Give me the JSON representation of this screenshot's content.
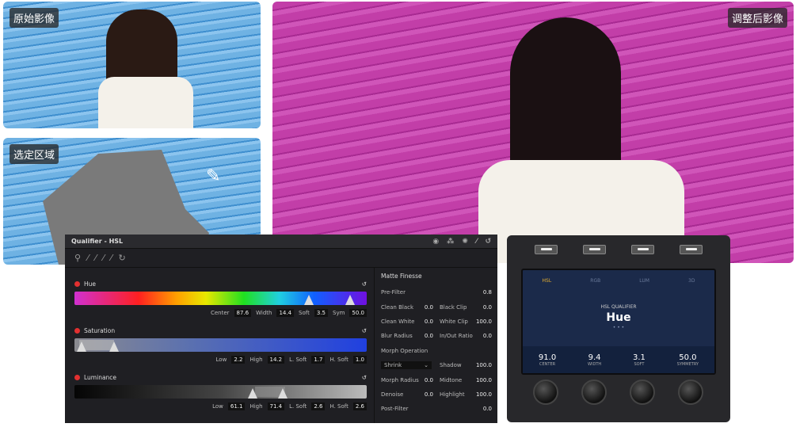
{
  "photos": {
    "original_label": "原始影像",
    "adjusted_label": "调整后影像",
    "selection_label": "选定区域"
  },
  "panel": {
    "title": "Qualifier - HSL",
    "hue": {
      "title": "Hue",
      "fields": [
        {
          "label": "Center",
          "value": "87.6"
        },
        {
          "label": "Width",
          "value": "14.4"
        },
        {
          "label": "Soft",
          "value": "3.5"
        },
        {
          "label": "Sym",
          "value": "50.0"
        }
      ]
    },
    "saturation": {
      "title": "Saturation",
      "fields": [
        {
          "label": "Low",
          "value": "2.2"
        },
        {
          "label": "High",
          "value": "14.2"
        },
        {
          "label": "L. Soft",
          "value": "1.7"
        },
        {
          "label": "H. Soft",
          "value": "1.0"
        }
      ]
    },
    "luminance": {
      "title": "Luminance",
      "fields": [
        {
          "label": "Low",
          "value": "61.1"
        },
        {
          "label": "High",
          "value": "71.4"
        },
        {
          "label": "L. Soft",
          "value": "2.6"
        },
        {
          "label": "H. Soft",
          "value": "2.6"
        }
      ]
    },
    "matte": {
      "title": "Matte Finesse",
      "prefilter_label": "Pre-Filter",
      "prefilter_value": "0.8",
      "rows": [
        [
          {
            "label": "Clean Black",
            "value": "0.0"
          },
          {
            "label": "Black Clip",
            "value": "0.0"
          }
        ],
        [
          {
            "label": "Clean White",
            "value": "0.0"
          },
          {
            "label": "White Clip",
            "value": "100.0"
          }
        ],
        [
          {
            "label": "Blur Radius",
            "value": "0.0"
          },
          {
            "label": "In/Out Ratio",
            "value": "0.0"
          }
        ]
      ],
      "morph_label": "Morph Operation",
      "morph_select": "Shrink",
      "shadow_label": "Shadow",
      "shadow_value": "100.0",
      "rows2": [
        [
          {
            "label": "Morph Radius",
            "value": "0.0"
          },
          {
            "label": "Midtone",
            "value": "100.0"
          }
        ],
        [
          {
            "label": "Denoise",
            "value": "0.0"
          },
          {
            "label": "Highlight",
            "value": "100.0"
          }
        ]
      ],
      "postfilter_label": "Post-Filter",
      "postfilter_value": "0.0"
    }
  },
  "device": {
    "tabs": [
      "HSL",
      "RGB",
      "LUM",
      "3D"
    ],
    "subtitle": "HSL QUALIFIER",
    "title": "Hue",
    "dots": "• • •",
    "readouts": [
      {
        "value": "91.0",
        "label": "CENTER"
      },
      {
        "value": "9.4",
        "label": "WIDTH"
      },
      {
        "value": "3.1",
        "label": "SOFT"
      },
      {
        "value": "50.0",
        "label": "SYMMETRY"
      }
    ]
  }
}
